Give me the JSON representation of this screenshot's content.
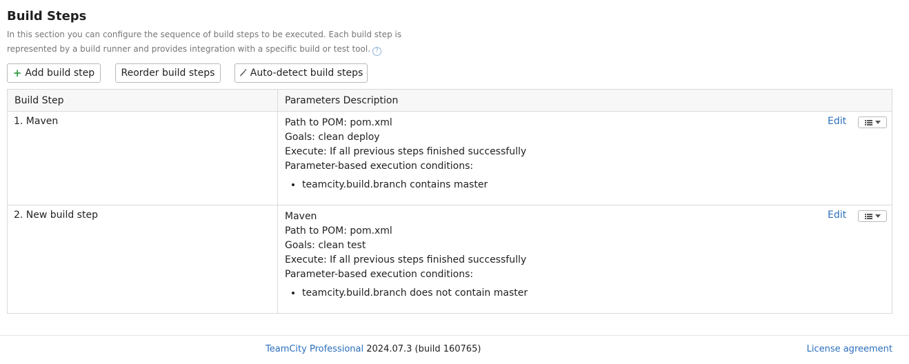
{
  "page": {
    "title": "Build Steps",
    "description": "In this section you can configure the sequence of build steps to be executed. Each build step is represented by a build runner and provides integration with a specific build or test tool.",
    "help_glyph": "?"
  },
  "toolbar": {
    "add_label": "Add build step",
    "reorder_label": "Reorder build steps",
    "autodetect_label": "Auto-detect build steps"
  },
  "table": {
    "headers": [
      "Build Step",
      "Parameters Description"
    ],
    "rows": [
      {
        "name": "1. Maven",
        "params": [
          "Path to POM: pom.xml",
          "Goals: clean deploy",
          "Execute: If all previous steps finished successfully",
          "Parameter-based execution conditions:"
        ],
        "conditions": [
          "teamcity.build.branch contains master"
        ],
        "edit_label": "Edit"
      },
      {
        "name": "2. New build step",
        "params": [
          "Maven",
          "Path to POM: pom.xml",
          "Goals: clean test",
          "Execute: If all previous steps finished successfully",
          "Parameter-based execution conditions:"
        ],
        "conditions": [
          "teamcity.build.branch does not contain master"
        ],
        "edit_label": "Edit"
      }
    ]
  },
  "footer": {
    "product": "TeamCity Professional",
    "version": "2024.07.3 (build 160765)",
    "license": "License agreement"
  },
  "icons": {
    "add": "plus-icon",
    "autodetect": "magic-wand-icon",
    "help": "help-icon",
    "menu": "list-icon",
    "dropdown": "caret-down-icon"
  },
  "colors": {
    "link": "#2a6ebb",
    "add_icon": "#2e9e45",
    "muted_text": "#767676"
  }
}
